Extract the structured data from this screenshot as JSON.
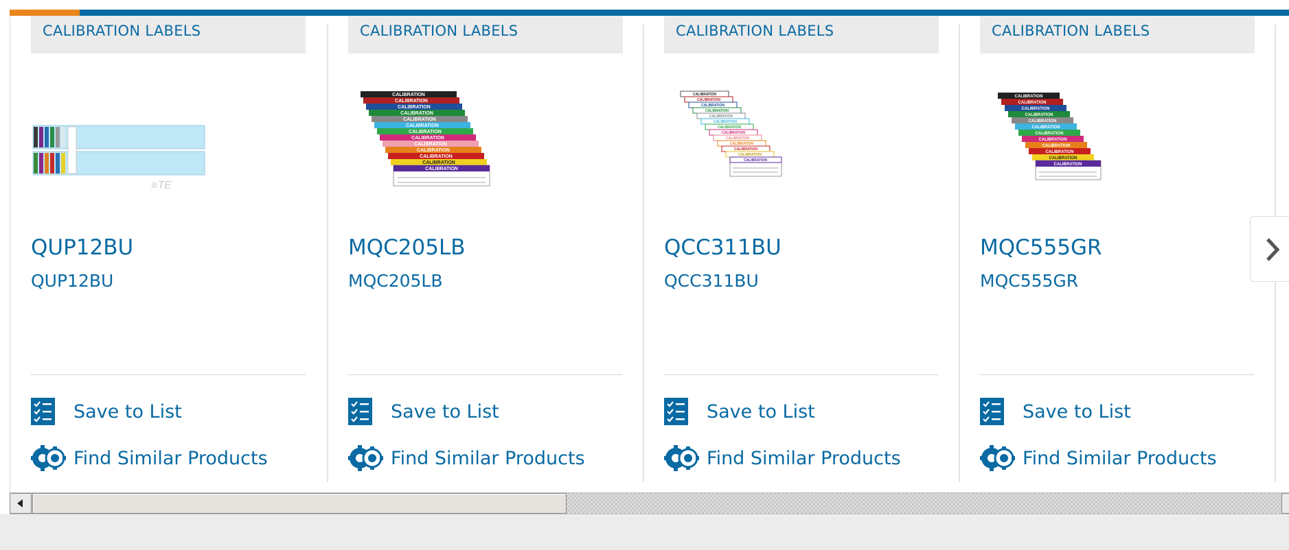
{
  "colors": {
    "brand_blue": "#0a6aa3",
    "accent_orange": "#e8861b",
    "category_bg": "#ebebeb"
  },
  "cards": [
    {
      "category": "CALIBRATION LABELS",
      "name": "QUP12BU",
      "subname": "QUP12BU",
      "image_icon": "label-sheet-image",
      "save_label": "Save to List",
      "similar_label": "Find Similar Products"
    },
    {
      "category": "CALIBRATION LABELS",
      "name": "MQC205LB",
      "subname": "MQC205LB",
      "image_icon": "label-stack-image",
      "save_label": "Save to List",
      "similar_label": "Find Similar Products"
    },
    {
      "category": "CALIBRATION LABELS",
      "name": "QCC311BU",
      "subname": "QCC311BU",
      "image_icon": "label-stack-image",
      "save_label": "Save to List",
      "similar_label": "Find Similar Products"
    },
    {
      "category": "CALIBRATION LABELS",
      "name": "MQC555GR",
      "subname": "MQC555GR",
      "image_icon": "label-stack-image",
      "save_label": "Save to List",
      "similar_label": "Find Similar Products"
    }
  ],
  "icons": {
    "save": "checklist-icon",
    "similar": "gears-icon",
    "next": "chevron-right-icon"
  },
  "label_image_text": "CALIBRATION"
}
